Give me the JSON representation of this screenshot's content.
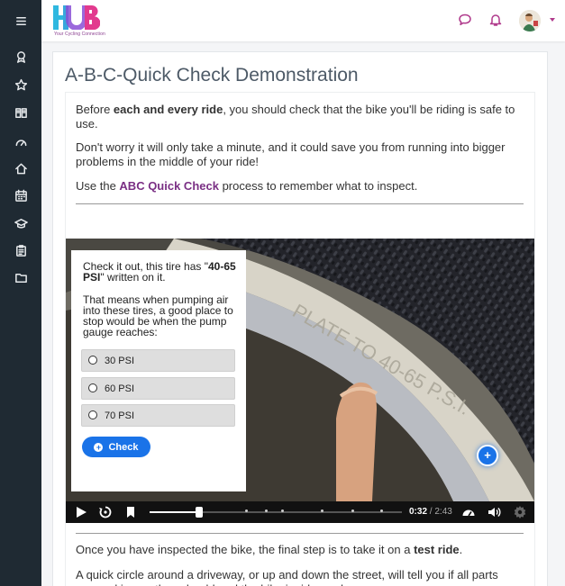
{
  "app": {
    "logo_text": "HUB",
    "logo_tagline": "Your Cycling Connection",
    "colors": {
      "sidebar_bg": "#1f2a33",
      "accent": "#b03a8c",
      "link": "#7a2f84",
      "button": "#1a73e8"
    }
  },
  "sidebar": {
    "items": [
      {
        "icon": "menu-icon"
      },
      {
        "icon": "award-icon"
      },
      {
        "icon": "star-icon"
      },
      {
        "icon": "book-icon"
      },
      {
        "icon": "dashboard-icon"
      },
      {
        "icon": "home-icon"
      },
      {
        "icon": "calendar-icon"
      },
      {
        "icon": "graduation-cap-icon"
      },
      {
        "icon": "clipboard-icon"
      },
      {
        "icon": "folder-icon"
      }
    ]
  },
  "topbar": {
    "icons": [
      "chat-icon",
      "bell-icon",
      "user-avatar"
    ]
  },
  "page": {
    "title": "A-B-C-Quick Check Demonstration"
  },
  "content": {
    "p1_pre": "Before ",
    "p1_bold": "each and every ride",
    "p1_post": ", you should check that the bike you'll be riding is safe to use.",
    "p2": "Don't worry it will only take a minute, and it could save you from running into bigger problems in the middle of your ride!",
    "p3_pre": "Use the ",
    "p3_link": "ABC Quick Check",
    "p3_post": " process to remember what to inspect.",
    "after1_pre": "Once you have inspected the bike, the final step is to take it on a ",
    "after1_bold": "test ride",
    "after1_post": ".",
    "after2": "A quick circle around a driveway, or up and down the street, will tell you if all parts are working as they should and the bike is ride ready."
  },
  "quiz": {
    "question_pre": "Check it out, this tire has \"",
    "question_bold": "40-65 PSI",
    "question_post": "\" written on it.",
    "question2": "That means when pumping air into these tires, a good place to stop would be when the pump gauge reaches:",
    "options": [
      "30 PSI",
      "60 PSI",
      "70 PSI"
    ],
    "check_label": "Check"
  },
  "video": {
    "current_time": "0:32",
    "separator": " / ",
    "duration": "2:43",
    "progress_fraction": 0.196,
    "hotspot_label": "+"
  }
}
